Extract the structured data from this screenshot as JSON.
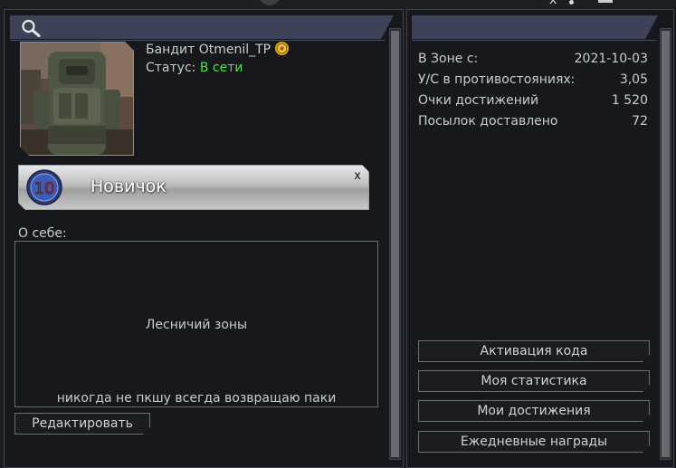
{
  "profile": {
    "username": "Бандит Otmenil_TP",
    "status_label": "Статус:",
    "status_value": "В сети",
    "status_color": "#4be34f"
  },
  "rank": {
    "level": "10",
    "name": "Новичок",
    "close_label": "x"
  },
  "about": {
    "label": "О себе:",
    "line1": "Лесничий зоны",
    "line2": "никогда не пкшу всегда возвращаю паки"
  },
  "edit_button_label": "Редактировать",
  "stats": [
    {
      "label": "В Зоне с:",
      "value": "2021-10-03"
    },
    {
      "label": "У/С в противостояниях:",
      "value": "3,05"
    },
    {
      "label": "Очки достижений",
      "value": "1 520"
    },
    {
      "label": "Посылок доставлено",
      "value": "72"
    }
  ],
  "right_buttons": [
    {
      "label": "Активация кода"
    },
    {
      "label": "Моя статистика"
    },
    {
      "label": "Мои достижения"
    },
    {
      "label": "Ежедневные награды"
    }
  ],
  "window_controls": {
    "close_glyph": "x"
  },
  "icons": {
    "search": "search-icon",
    "rank_badge": "gear-badge-icon",
    "rank_circle": "rank-level-icon"
  },
  "colors": {
    "header": "#3d4259",
    "background": "#16181b",
    "online": "#4be34f",
    "rank_digits": "#d82020"
  }
}
